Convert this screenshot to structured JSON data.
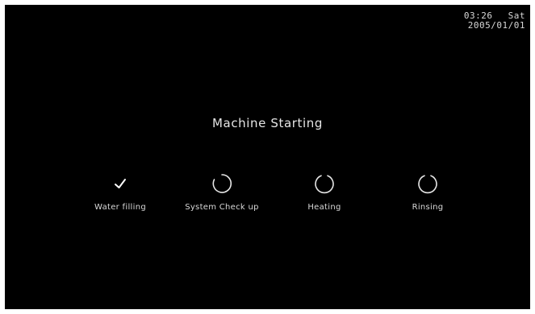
{
  "status": {
    "time": "03:26",
    "day": "Sat",
    "date": "2005/01/01"
  },
  "screen": {
    "title": "Machine Starting"
  },
  "steps": [
    {
      "label": "Water filling",
      "state": "done",
      "icon": "check-icon"
    },
    {
      "label": "System Check up",
      "state": "in-progress",
      "icon": "spinner-icon"
    },
    {
      "label": "Heating",
      "state": "pending",
      "icon": "spinner-icon"
    },
    {
      "label": "Rinsing",
      "state": "pending",
      "icon": "spinner-icon"
    }
  ],
  "colors": {
    "background": "#000000",
    "text": "#e6e6e6"
  }
}
